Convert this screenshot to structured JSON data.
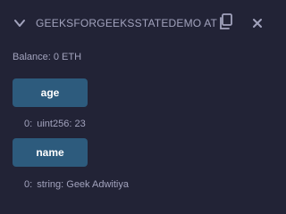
{
  "header": {
    "title": "GEEKSFORGEEKSSTATEDEMO AT",
    "icons": {
      "collapse": "chevron-down-icon",
      "copy": "copy-icon",
      "close": "close-icon"
    }
  },
  "balance": {
    "text": "Balance: 0 ETH"
  },
  "functions": [
    {
      "label": "age",
      "result_index": "0:",
      "result_value": "uint256: 23"
    },
    {
      "label": "name",
      "result_index": "0:",
      "result_value": "string: Geek Adwitiya"
    }
  ],
  "colors": {
    "background": "#222336",
    "text": "#a2a3bd",
    "button": "#2d5b7d",
    "button_text": "#ffffff"
  }
}
